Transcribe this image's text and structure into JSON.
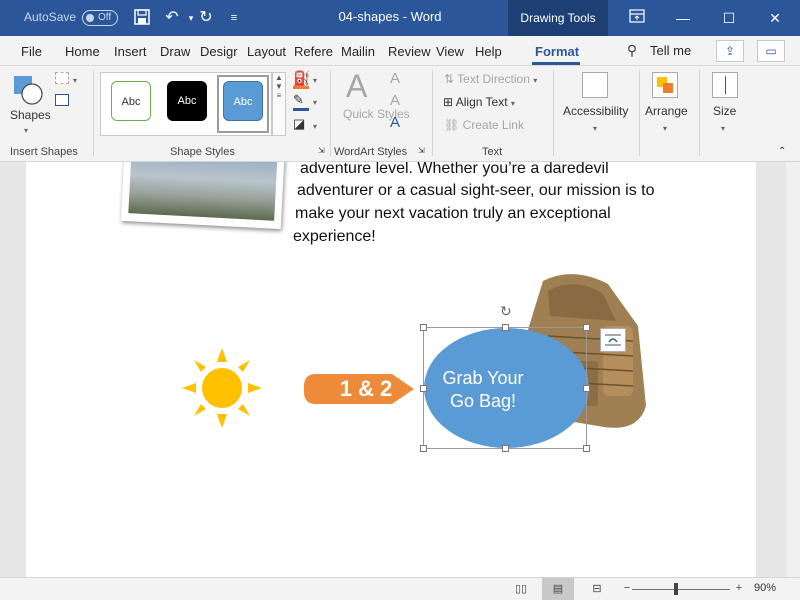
{
  "titlebar": {
    "autosave_label": "AutoSave",
    "autosave_state": "Off",
    "doc_title": "04-shapes - Word",
    "context_tab": "Drawing Tools",
    "bg_color": "#2b579a"
  },
  "tabs": [
    {
      "label": "File"
    },
    {
      "label": "Home"
    },
    {
      "label": "Insert"
    },
    {
      "label": "Draw"
    },
    {
      "label": "Desigr"
    },
    {
      "label": "Layout"
    },
    {
      "label": "Refere"
    },
    {
      "label": "Mailin"
    },
    {
      "label": "Review"
    },
    {
      "label": "View"
    },
    {
      "label": "Help"
    },
    {
      "label": "Format"
    }
  ],
  "tell_me": "Tell me",
  "ribbon": {
    "insert_shapes": {
      "shapes_label": "Shapes",
      "group_label": "Insert Shapes"
    },
    "shape_styles": {
      "swatch_labels": [
        "Abc",
        "Abc",
        "Abc"
      ],
      "group_label": "Shape Styles"
    },
    "wordart": {
      "quick_styles_label": "Quick Styles",
      "group_label": "WordArt Styles"
    },
    "text": {
      "text_direction": "Text Direction",
      "align_text": "Align Text",
      "create_link": "Create Link",
      "group_label": "Text"
    },
    "accessibility": "Accessibility",
    "arrange": "Arrange",
    "size": "Size"
  },
  "document": {
    "paragraph_lines": [
      "adventure level. Whether you’re a daredevil",
      "adventurer or a casual sight-seer, our mission is to",
      "make your next vacation truly an exceptional",
      "experience!"
    ],
    "callout_text": "1 & 2",
    "callout_color": "#ed8b3a",
    "oval_text_line1": "Grab Your",
    "oval_text_line2": "Go Bag!",
    "oval_color": "#5b9bd5",
    "sun_color": "#ffc000"
  },
  "statusbar": {
    "zoom_level": "90%"
  }
}
